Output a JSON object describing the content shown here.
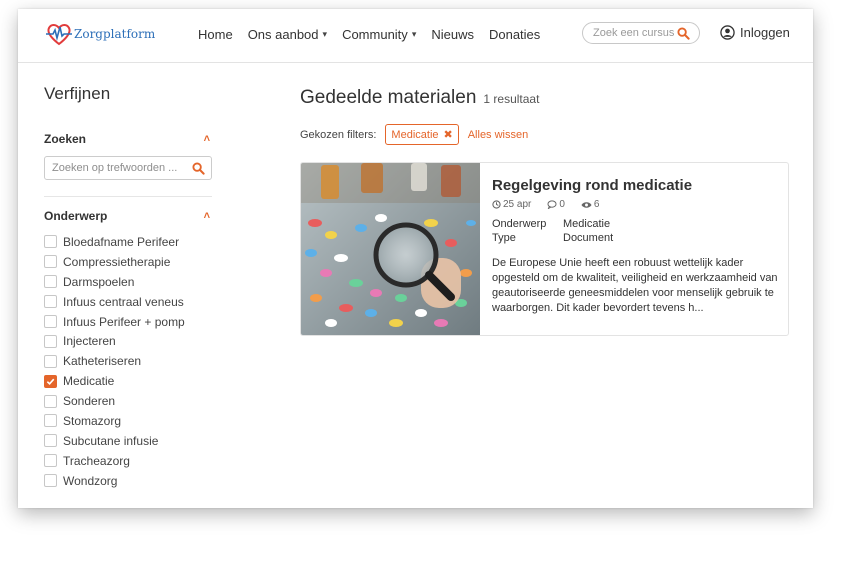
{
  "brand": {
    "name": "Zorgplatform",
    "accent": "#e4652a",
    "logo_red": "#e23c3c",
    "logo_blue": "#2d6fb8"
  },
  "nav": {
    "items": [
      {
        "label": "Home",
        "dropdown": false
      },
      {
        "label": "Ons aanbod",
        "dropdown": true
      },
      {
        "label": "Community",
        "dropdown": true
      },
      {
        "label": "Nieuws",
        "dropdown": false
      },
      {
        "label": "Donaties",
        "dropdown": false
      }
    ],
    "search_placeholder": "Zoek een cursus",
    "login_label": "Inloggen"
  },
  "sidebar": {
    "title": "Verfijnen",
    "search_section": {
      "label": "Zoeken",
      "placeholder": "Zoeken op trefwoorden ..."
    },
    "topic_section": {
      "label": "Onderwerp",
      "options": [
        {
          "label": "Bloedafname Perifeer",
          "checked": false
        },
        {
          "label": "Compressietherapie",
          "checked": false
        },
        {
          "label": "Darmspoelen",
          "checked": false
        },
        {
          "label": "Infuus centraal veneus",
          "checked": false
        },
        {
          "label": "Infuus Perifeer + pomp",
          "checked": false
        },
        {
          "label": "Injecteren",
          "checked": false
        },
        {
          "label": "Katheteriseren",
          "checked": false
        },
        {
          "label": "Medicatie",
          "checked": true
        },
        {
          "label": "Sonderen",
          "checked": false
        },
        {
          "label": "Stomazorg",
          "checked": false
        },
        {
          "label": "Subcutane infusie",
          "checked": false
        },
        {
          "label": "Tracheazorg",
          "checked": false
        },
        {
          "label": "Wondzorg",
          "checked": false
        }
      ]
    }
  },
  "main": {
    "title": "Gedeelde materialen",
    "result_count": "1 resultaat",
    "filters_label": "Gekozen filters:",
    "active_filter": "Medicatie",
    "clear_label": "Alles wissen",
    "results": [
      {
        "title": "Regelgeving rond medicatie",
        "date": "25 apr",
        "comments": "0",
        "views": "6",
        "subject_key": "Onderwerp",
        "subject_value": "Medicatie",
        "type_key": "Type",
        "type_value": "Document",
        "description": "De Europese Unie heeft een robuust wettelijk kader opgesteld om de kwaliteit, veiligheid en werkzaamheid van geautoriseerde geneesmiddelen voor menselijk gebruik te waarborgen. Dit kader bevordert tevens h..."
      }
    ]
  }
}
